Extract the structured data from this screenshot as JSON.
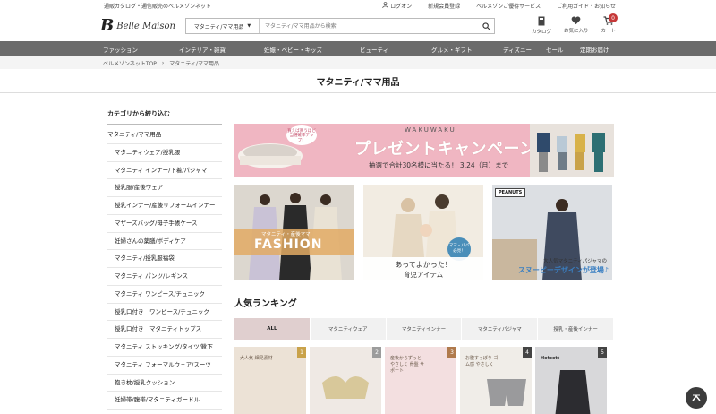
{
  "util": {
    "tagline": "通販カタログ・通信販売のベルメゾンネット",
    "links": [
      "ログオン",
      "新規会員登録",
      "ベルメゾンご優待サービス",
      "ご利用ガイド・お知らせ"
    ]
  },
  "header": {
    "logo_text": "Belle Maison",
    "search_category": "マタニティ/ママ用品",
    "search_placeholder": "マタニティ/ママ用品から検索",
    "icons": [
      {
        "label": "カタログ",
        "icon": "catalog-icon"
      },
      {
        "label": "お気に入り",
        "icon": "heart-icon"
      },
      {
        "label": "カート",
        "icon": "cart-icon",
        "badge": "0"
      }
    ]
  },
  "nav": [
    "ファッション",
    "インテリア・雑貨",
    "妊娠・ベビー・キッズ",
    "ビューティ",
    "グルメ・ギフト",
    "ディズニー",
    "セール",
    "定期お届け"
  ],
  "breadcrumb": [
    "ベルメゾンネットTOP",
    "マタニティ/ママ用品"
  ],
  "page_title": "マタニティ/ママ用品",
  "sidebar": {
    "heading": "カテゴリから絞り込む",
    "top_item": "マタニティ/ママ用品",
    "items": [
      "マタニティウェア/授乳服",
      "マタニティ インナー/下着/パジャマ",
      "授乳服/産後ウェア",
      "授乳インナー/産後リフォームインナー",
      "マザーズバッグ/母子手帳ケース",
      "妊婦さんの薬膳/ボディケア",
      "マタニティ/授乳服福袋",
      "マタニティ パンツ/レギンス",
      "マタニティ ワンピース/チュニック",
      "授乳口付き　ワンピース/チュニック",
      "授乳口付き　マタニティトップス",
      "マタニティ ストッキング/タイツ/靴下",
      "マタニティ フォーマルウェア/スーツ",
      "抱き枕/授乳クッション",
      "妊婦帯/腹帯/マタニティガードル"
    ]
  },
  "banner": {
    "circle_text": "買えば買うほど当選確率アップ！",
    "eyebrow": "WAKUWAKU",
    "headline": "プレゼントキャンペーン",
    "subline": "抽選で合計30名様に当たる！ 3.24（月）まで"
  },
  "cards": {
    "fashion_small": "マタニティ・産後ママ",
    "fashion_big": "FASHION",
    "baby_bubble": "ママ・パパ必見！",
    "baby_line1": "あってよかった！",
    "baby_line2": "育児アイテム",
    "peanuts_logo": "PEANUTS",
    "snoopy_line1": "大人気マタニティパジャマの",
    "snoopy_line2": "スヌーピーデザインが登場♪"
  },
  "ranking": {
    "title": "人気ランキング",
    "tabs": [
      "ALL",
      "マタニティウェア",
      "マタニティインナー",
      "マタニティパジャマ",
      "授乳・産後インナー"
    ],
    "products": [
      {
        "rank": "1",
        "text": "大人気 細見素材"
      },
      {
        "rank": "2",
        "text": ""
      },
      {
        "rank": "3",
        "text": "産後からずっと やさしく 骨盤 サポート"
      },
      {
        "rank": "4",
        "text": "お腹すっぽり ゴム感 やさしく"
      },
      {
        "rank": "5",
        "text": "Hotcott"
      }
    ]
  },
  "colors": {
    "nav_bg": "#6b6b6b",
    "banner_pink": "#f0b6c2",
    "active_tab": "#e0cfcf",
    "badge_red": "#c63838"
  }
}
